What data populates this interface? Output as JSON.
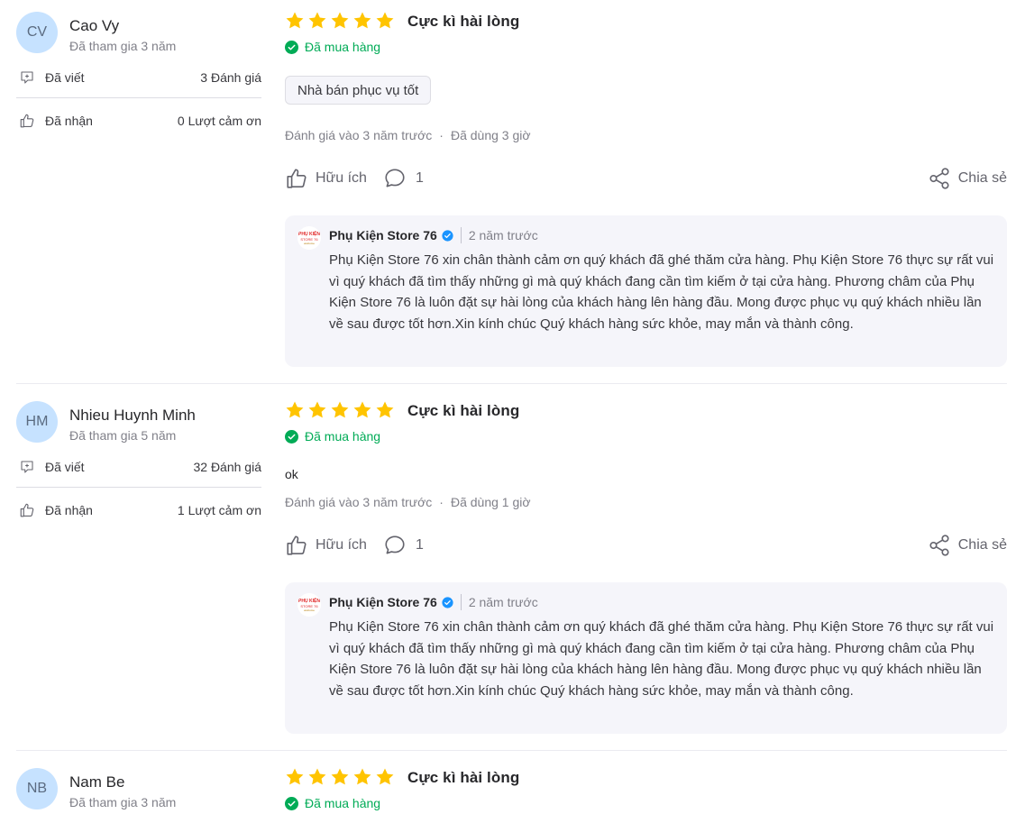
{
  "reviews": [
    {
      "user": {
        "initials": "CV",
        "name": "Cao Vy",
        "joined": "Đã tham gia 3 năm",
        "written_label": "Đã viết",
        "written_value": "3 Đánh giá",
        "received_label": "Đã nhận",
        "received_value": "0 Lượt cảm ơn"
      },
      "rating_stars": 5,
      "rating_title": "Cực kì hài lòng",
      "bought": "Đã mua hàng",
      "tag": "Nhà bán phục vụ tốt",
      "comment": "",
      "reviewed": "Đánh giá vào 3 năm trước",
      "used": "Đã dùng 3 giờ",
      "helpful": "Hữu ích",
      "comment_count": "1",
      "share": "Chia sẻ",
      "reply": {
        "seller": "Phụ Kiện Store 76",
        "time": "2 năm trước",
        "logo": [
          "PHỤ KIỆN",
          "STORE 76",
          "welcome"
        ],
        "text": "Phụ Kiện Store 76 xin chân thành cảm ơn quý khách đã ghé thăm cửa hàng. Phụ Kiện Store 76 thực sự rất vui vì quý khách đã tìm thấy những gì mà quý khách đang cần tìm kiếm ở tại cửa hàng. Phương châm của Phụ Kiện Store 76 là luôn đặt sự hài lòng của khách hàng lên hàng đầu. Mong được phục vụ quý khách nhiều lần về sau được tốt hơn.Xin kính chúc Quý khách hàng sức khỏe, may mắn và thành công."
      }
    },
    {
      "user": {
        "initials": "HM",
        "name": "Nhieu Huynh Minh",
        "joined": "Đã tham gia 5 năm",
        "written_label": "Đã viết",
        "written_value": "32 Đánh giá",
        "received_label": "Đã nhận",
        "received_value": "1 Lượt cảm ơn"
      },
      "rating_stars": 5,
      "rating_title": "Cực kì hài lòng",
      "bought": "Đã mua hàng",
      "tag": "",
      "comment": "ok",
      "reviewed": "Đánh giá vào 3 năm trước",
      "used": "Đã dùng 1 giờ",
      "helpful": "Hữu ích",
      "comment_count": "1",
      "share": "Chia sẻ",
      "reply": {
        "seller": "Phụ Kiện Store 76",
        "time": "2 năm trước",
        "logo": [
          "PHỤ KIỆN",
          "STORE 76",
          "welcome"
        ],
        "text": "Phụ Kiện Store 76 xin chân thành cảm ơn quý khách đã ghé thăm cửa hàng. Phụ Kiện Store 76 thực sự rất vui vì quý khách đã tìm thấy những gì mà quý khách đang cần tìm kiếm ở tại cửa hàng. Phương châm của Phụ Kiện Store 76 là luôn đặt sự hài lòng của khách hàng lên hàng đầu. Mong được phục vụ quý khách nhiều lần về sau được tốt hơn.Xin kính chúc Quý khách hàng sức khỏe, may mắn và thành công."
      }
    },
    {
      "user": {
        "initials": "NB",
        "name": "Nam Be",
        "joined": "Đã tham gia 3 năm"
      },
      "rating_stars": 5,
      "rating_title": "Cực kì hài lòng",
      "bought": "Đã mua hàng"
    }
  ],
  "colors": {
    "star": "#ffc400",
    "bought": "#00ab56",
    "avatar_bg": "#c6e2ff",
    "reply_bg": "#f5f5fa",
    "verified": "#1a94ff"
  }
}
